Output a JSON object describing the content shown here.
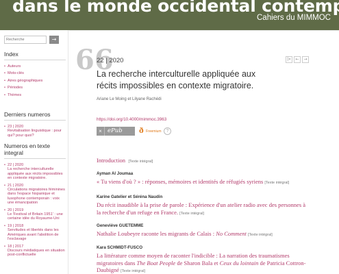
{
  "header": {
    "title": "dans le monde occidental contemporain",
    "series": "Cahiers du MIMMOC"
  },
  "sidebar": {
    "search_placeholder": "Recherche",
    "search_button": "→",
    "index_heading": "Index",
    "index_items": [
      "Auteurs",
      "Mots-clés",
      "Aires géographiques",
      "Périodes",
      "Thèmes"
    ],
    "latest_heading": "Derniers numeros",
    "latest_items": [
      {
        "num": "23 | 2020",
        "title": "Revitalisation linguistique : pour qui? pour quoi?"
      }
    ],
    "fulltext_heading": "Numeros en texte integral",
    "fulltext_items": [
      {
        "num": "22 | 2020",
        "title": "La recherche interculturelle appliquée aux récits impossibles en contexte migratoire."
      },
      {
        "num": "21 | 2020",
        "title": "Circulations migratoires féminines dans l'espace hispanique et lusophone contemporain : voix une émancipation"
      },
      {
        "num": "20 | 2019",
        "title": "Le 'Festival of Britain 1951' : une certaine idée du Royaume-Uni"
      },
      {
        "num": "19 | 2018",
        "title": "Servitudes et libertés dans les Amériques avant l'abolition de l'esclavage"
      },
      {
        "num": "18 | 2017",
        "title": "Discours médiatiques en situation post-conflictuelle"
      }
    ]
  },
  "article": {
    "quote_glyph": "66",
    "issue": "22 | 2020",
    "title": "La recherche interculturelle appliquée aux récits impossibles en contexte migratoire.",
    "authors": "Ariane Le Moing et Lilyane Rachédi",
    "nav": {
      "first": "|«",
      "prev": "←",
      "next": "→"
    },
    "doi": "https://doi.org/10.4000/mimmoc.3963",
    "epub_x": "×",
    "epub_label": "ePub",
    "freemium_logo": "ð",
    "freemium_label": "Freemium",
    "help_glyph": "?"
  },
  "toc": {
    "intro": {
      "title": "Introduction",
      "note": "[Texte intégral]"
    },
    "entries": [
      {
        "author": "Ayman Al Joumaa",
        "title": "« Tu viens d'où ? » : réponses, mémoires et identités de réfugiés syriens",
        "note": "[Texte intégral]"
      },
      {
        "author": "Karine Gatelier et Séréna Naudin",
        "title": "Du récit inaudible à la prise de parole : Expérience d'un atelier radio avec des personnes à la recherche d'un refuge en France.",
        "note": "[Texte intégral]"
      },
      {
        "author": "Geneviève GUETEMME",
        "title_pre": "Nathalie Loubeyre raconte les migrants de Calais : ",
        "title_em": "No Comment",
        "note": "[Texte intégral]"
      },
      {
        "author": "Kara SCHMIDT-FUSCO",
        "title_pre": "La littérature comme moyen de raconter l'indicible : La narration des traumatismes migratoires dans ",
        "title_em": "The Boat People",
        "title_mid": " de Sharon Bala et ",
        "title_em2": "Ceux du lointain",
        "title_post": " de Patricia Cottron-Daubigné",
        "note": "[Texte intégral]"
      }
    ]
  },
  "colors": {
    "banner": "#5f6b47",
    "link": "#b23a6a",
    "freemium": "#e07a1a"
  }
}
